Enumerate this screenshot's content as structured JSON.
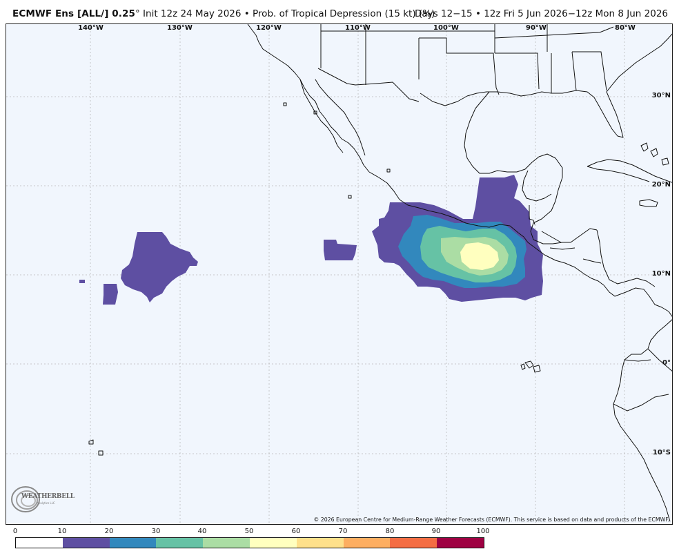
{
  "header": {
    "title_bold": "ECMWF Ens [ALL/] 0.25",
    "title_deg": "°",
    "title_rest": " Init 12z 24 May 2026 • Prob. of Tropical Depression (15 kt) (%)",
    "period": "Days 12−15 • 12z Fri 5 Jun 2026−12z Mon 8 Jun 2026"
  },
  "map": {
    "longitude_labels": [
      "140°W",
      "130°W",
      "120°W",
      "110°W",
      "100°W",
      "90°W",
      "80°W"
    ],
    "latitude_labels": [
      "30°N",
      "20°N",
      "10°N",
      "0°",
      "10°S"
    ],
    "copyright": "© 2026 European Centre for Medium-Range Weather Forecasts (ECMWF). This service is based on data and products of the ECMWF.",
    "logo_text": "WEATHERBELL",
    "logo_subtext": "Analytics LLC",
    "ocean_color": "#f1f6fd",
    "grid": true
  },
  "colorbar": {
    "ticks": [
      "0",
      "10",
      "20",
      "30",
      "40",
      "50",
      "60",
      "70",
      "80",
      "90",
      "100"
    ],
    "colors": [
      "#ffffff",
      "#5e4fa2",
      "#3288bd",
      "#66c2a5",
      "#abdda4",
      "#ffffbf",
      "#fee08b",
      "#fdae61",
      "#f46d43",
      "#9e0142"
    ]
  }
}
